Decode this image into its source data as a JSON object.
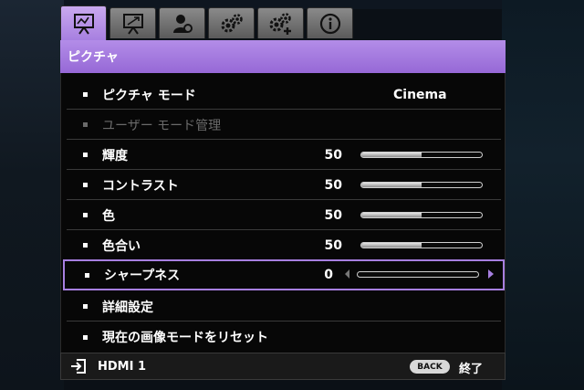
{
  "tabs": [
    {
      "icon": "picture-icon",
      "active": true
    },
    {
      "icon": "display-icon",
      "active": false
    },
    {
      "icon": "user-settings-icon",
      "active": false
    },
    {
      "icon": "gears-icon",
      "active": false
    },
    {
      "icon": "gears-plus-icon",
      "active": false
    },
    {
      "icon": "info-icon",
      "active": false
    }
  ],
  "header": {
    "title": "ピクチャ"
  },
  "menu": {
    "items": [
      {
        "label": "ピクチャ モード",
        "value": "Cinema"
      },
      {
        "label": "ユーザー モード管理",
        "disabled": true
      },
      {
        "label": "輝度",
        "value": "50",
        "level": 0.5
      },
      {
        "label": "コントラスト",
        "value": "50",
        "level": 0.5
      },
      {
        "label": "色",
        "value": "50",
        "level": 0.5
      },
      {
        "label": "色合い",
        "value": "50",
        "level": 0.5
      },
      {
        "label": "シャープネス",
        "value": "0",
        "level": 0.0,
        "selected": true
      },
      {
        "label": "詳細設定"
      },
      {
        "label": "現在の画像モードをリセット"
      }
    ]
  },
  "footer": {
    "input_icon": "input-source-icon",
    "source": "HDMI 1",
    "back_label": "BACK",
    "exit_label": "終了"
  },
  "colors": {
    "accent": "#a77fe0",
    "tab": "#6f6f6f",
    "background": "#070707"
  }
}
